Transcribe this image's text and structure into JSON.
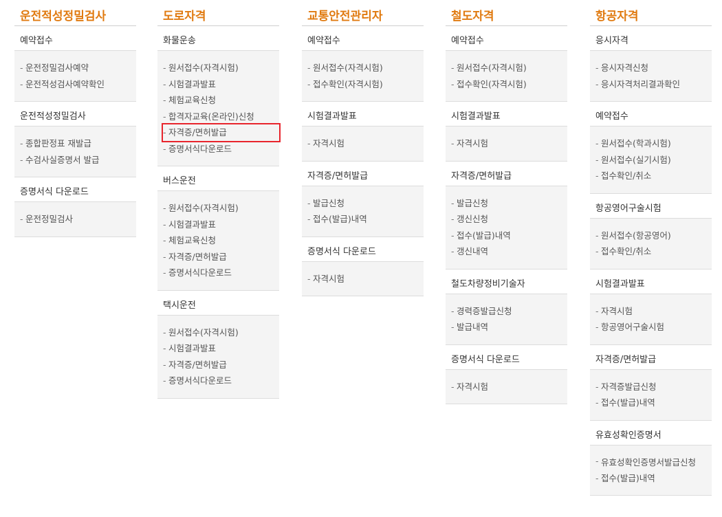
{
  "columns": [
    {
      "title": "운전적성정밀검사",
      "sections": [
        {
          "heading": "예약접수",
          "items": [
            "운전정밀검사예약",
            "운전적성검사예약확인"
          ]
        },
        {
          "heading": "운전적성정밀검사",
          "items": [
            "종합판정표 재발급",
            "수검사실증명서 발급"
          ]
        },
        {
          "heading": "증명서식 다운로드",
          "items": [
            "운전정밀검사"
          ]
        }
      ]
    },
    {
      "title": "도로자격",
      "sections": [
        {
          "heading": "화물운송",
          "items": [
            "원서접수(자격시험)",
            "시험결과발표",
            "체험교육신청",
            "합격자교육(온라인)신청",
            "자격증/면허발급",
            "증명서식다운로드"
          ]
        },
        {
          "heading": "버스운전",
          "items": [
            "원서접수(자격시험)",
            "시험결과발표",
            "체험교육신청",
            "자격증/면허발급",
            "증명서식다운로드"
          ]
        },
        {
          "heading": "택시운전",
          "items": [
            "원서접수(자격시험)",
            "시험결과발표",
            "자격증/면허발급",
            "증명서식다운로드"
          ]
        }
      ]
    },
    {
      "title": "교통안전관리자",
      "sections": [
        {
          "heading": "예약접수",
          "items": [
            "원서접수(자격시험)",
            "접수확인(자격시험)"
          ]
        },
        {
          "heading": "시험결과발표",
          "items": [
            "자격시험"
          ]
        },
        {
          "heading": "자격증/면허발급",
          "items": [
            "발급신청",
            "접수(발급)내역"
          ]
        },
        {
          "heading": "증명서식 다운로드",
          "items": [
            "자격시험"
          ]
        }
      ]
    },
    {
      "title": "철도자격",
      "sections": [
        {
          "heading": "예약접수",
          "items": [
            "원서접수(자격시험)",
            "접수확인(자격시험)"
          ]
        },
        {
          "heading": "시험결과발표",
          "items": [
            "자격시험"
          ]
        },
        {
          "heading": "자격증/면허발급",
          "items": [
            "발급신청",
            "갱신신청",
            "접수(발급)내역",
            "갱신내역"
          ]
        },
        {
          "heading": "철도차량정비기술자",
          "items": [
            "경력증발급신청",
            "발급내역"
          ]
        },
        {
          "heading": "증명서식 다운로드",
          "items": [
            "자격시험"
          ]
        }
      ]
    },
    {
      "title": "항공자격",
      "sections": [
        {
          "heading": "응시자격",
          "items": [
            "응시자격신청",
            "응시자격처리결과확인"
          ]
        },
        {
          "heading": "예약접수",
          "items": [
            "원서접수(학과시험)",
            "원서접수(실기시험)",
            "접수확인/취소"
          ]
        },
        {
          "heading": "항공영어구술시험",
          "items": [
            "원서접수(항공영어)",
            "접수확인/취소"
          ]
        },
        {
          "heading": "시험결과발표",
          "items": [
            "자격시험",
            "항공영어구술시험"
          ]
        },
        {
          "heading": "자격증/면허발급",
          "items": [
            "자격증발급신청",
            "접수(발급)내역"
          ]
        },
        {
          "heading": "유효성확인증명서",
          "items": [
            "유효성확인증명서발급신청",
            "접수(발급)내역"
          ]
        }
      ]
    }
  ],
  "colors": {
    "title": "#e07a10",
    "highlight_border": "#e8242c",
    "list_bg": "#f4f4f4"
  }
}
